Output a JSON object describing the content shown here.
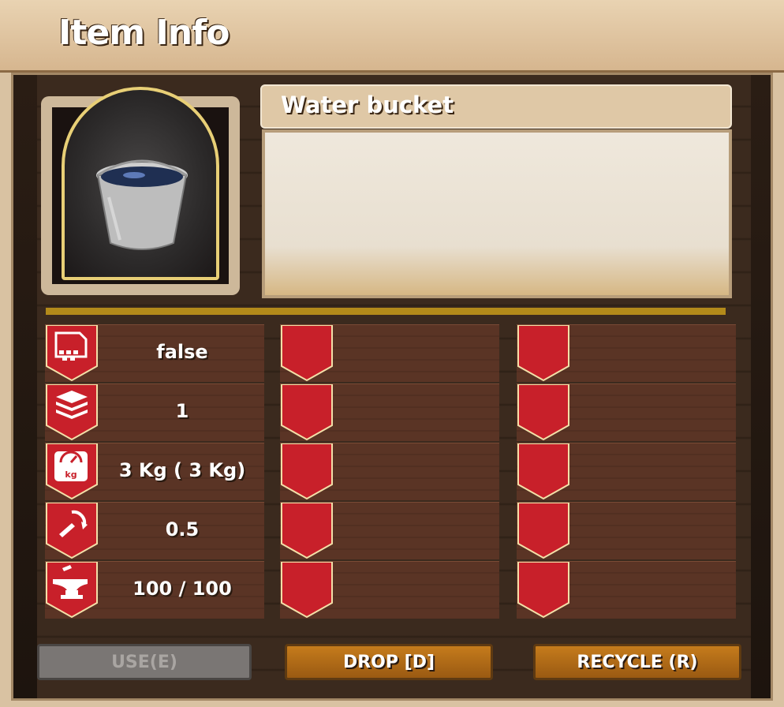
{
  "window": {
    "title": "Item Info"
  },
  "item": {
    "name": "Water bucket",
    "description": ""
  },
  "stats": [
    {
      "icon": "document-icon",
      "value": "false"
    },
    {
      "icon": "stack-icon",
      "value": "1"
    },
    {
      "icon": "weight-icon",
      "value": "3 Kg ( 3 Kg)"
    },
    {
      "icon": "repair-icon",
      "value": "0.5"
    },
    {
      "icon": "anvil-icon",
      "value": "100 / 100"
    }
  ],
  "colors": {
    "ribbon": "#c8202a",
    "ribbon_border": "#f3dfa8",
    "button_orange": "#c57b1c",
    "button_disabled": "#7a7674",
    "gold": "#b38a1a"
  },
  "buttons": {
    "use": "USE(E)",
    "drop": "DROP [D]",
    "recycle": "RECYCLE (R)"
  }
}
